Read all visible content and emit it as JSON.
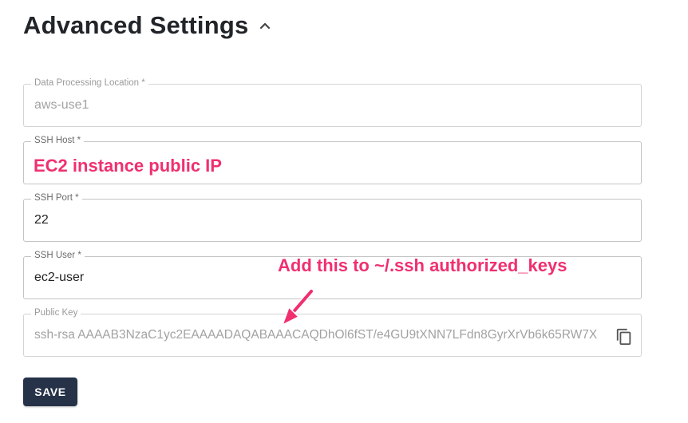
{
  "section": {
    "title": "Advanced Settings",
    "toggle_icon": "chevron-up-icon"
  },
  "fields": {
    "location": {
      "label": "Data Processing Location *",
      "value": "aws-use1",
      "disabled": true
    },
    "host": {
      "label": "SSH Host *",
      "value": ""
    },
    "port": {
      "label": "SSH Port *",
      "value": "22"
    },
    "user": {
      "label": "SSH User *",
      "value": "ec2-user"
    },
    "public_key": {
      "label": "Public Key",
      "value": "ssh-rsa AAAAB3NzaC1yc2EAAAADAQABAAACAQDhOl6fST/e4GU9tXNN7LFdn8GyrXrVb6k65RW7X",
      "disabled": true,
      "copy_icon": "copy-icon"
    }
  },
  "annotations": {
    "host_hint": "EC2 instance public IP",
    "key_hint": "Add this to ~/.ssh authorized_keys",
    "color": "#f0306e"
  },
  "actions": {
    "save_label": "SAVE"
  },
  "colors": {
    "save_button_bg": "#263248"
  }
}
